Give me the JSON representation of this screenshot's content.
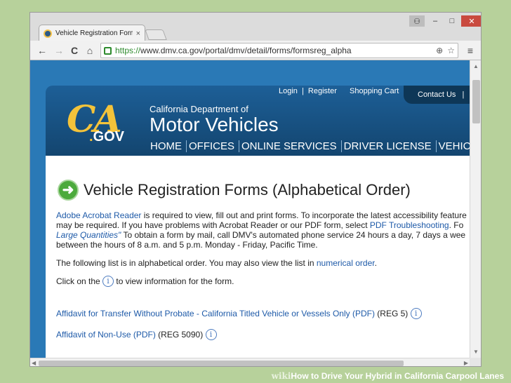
{
  "browser": {
    "tab_title": "Vehicle Registration Form",
    "tab_close": "×",
    "url_scheme": "https://",
    "url_rest": "www.dmv.ca.gov/portal/dmv/detail/forms/formsreg_alpha",
    "back_icon": "←",
    "forward_icon": "→",
    "reload_icon": "C",
    "home_icon": "⌂",
    "zoom_icon": "⊕",
    "star_icon": "☆",
    "menu_icon": "≡",
    "win_user": "⚇",
    "win_min": "–",
    "win_max": "□",
    "win_close": "✕"
  },
  "dmv": {
    "topnav_login": "Login",
    "topnav_sep": "|",
    "topnav_register": "Register",
    "topnav_cart": "Shopping Cart",
    "contact": "Contact Us",
    "contact_sep": "|",
    "logo_ca": "CA",
    "logo_dot": ".",
    "logo_gov": "GOV",
    "dept_line1": "California Department of",
    "dept_line2": "Motor Vehicles",
    "nav": [
      "HOME",
      "OFFICES",
      "ONLINE SERVICES",
      "DRIVER LICENSE",
      "VEHIC"
    ]
  },
  "content": {
    "arrow": "➜",
    "title": "Vehicle Registration Forms (Alphabetical Order)",
    "p1_link": "Adobe Acrobat Reader",
    "p1_a": " is required to view, fill out and print forms. To incorporate the latest accessibility feature",
    "p1_b": "may be required. If you have problems with Acrobat Reader or our PDF form, select ",
    "p1_link2": "PDF Troubleshooting",
    "p1_c": ". Fo",
    "p1_link3": "Large Quantities\"",
    "p1_d": " To obtain a form by mail, call DMV's automated phone service 24 hours a day, 7 days a wee",
    "p1_e": "between the hours of 8 a.m. and 5 p.m. Monday - Friday, Pacific Time.",
    "p2_a": "The following list is in alphabetical order. You may also view the list in ",
    "p2_link": "numerical order",
    "p2_b": ".",
    "p3_a": "Click on the ",
    "p3_b": " to view information for the form.",
    "info_glyph": "i",
    "forms": [
      {
        "name": "Affidavit for Transfer Without Probate - California Titled Vehicle or Vessels Only (PDF)",
        "code": " (REG 5)"
      },
      {
        "name": "Affidavit of Non-Use (PDF)",
        "code": " (REG 5090)"
      }
    ]
  },
  "caption": {
    "wiki": "wiki",
    "how": "How",
    "rest": " to Drive Your Hybrid in California Carpool Lanes"
  }
}
